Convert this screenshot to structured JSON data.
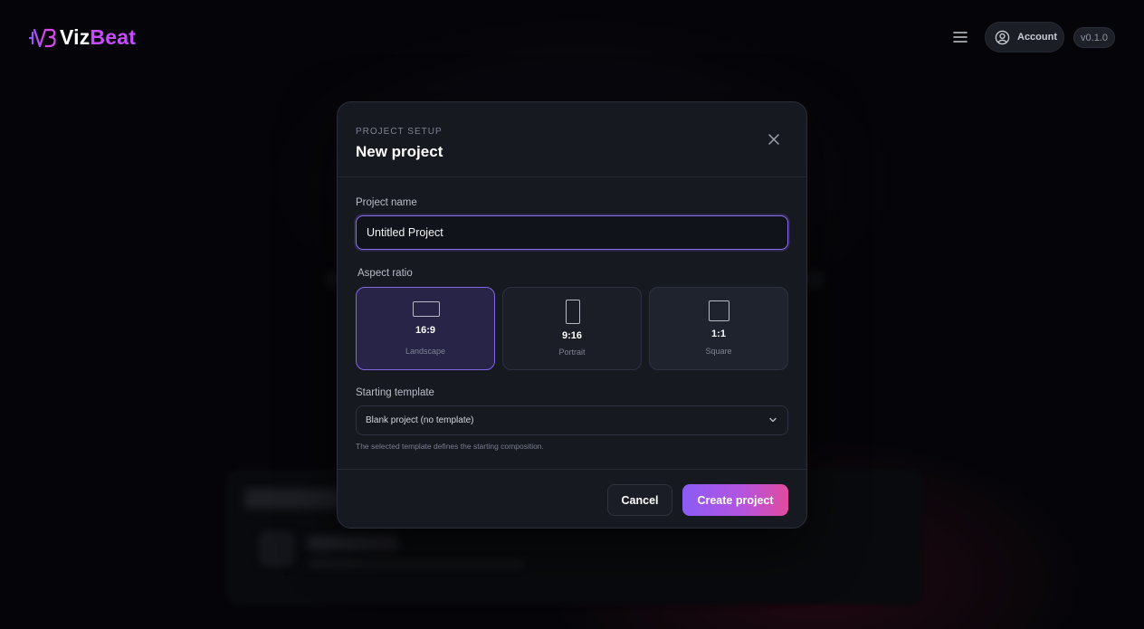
{
  "brand": {
    "prefix": "Viz",
    "suffix": "Beat",
    "accent": "#c84bff"
  },
  "header": {
    "account_label": "Account",
    "version": "v0.1.0",
    "menu_icon": "hamburger-icon",
    "account_icon": "user-circle-icon"
  },
  "modal": {
    "eyebrow": "PROJECT SETUP",
    "title": "New project",
    "close_icon": "close-icon",
    "name_label": "Project name",
    "name_value": "Untitled Project",
    "aspect_label": "Aspect ratio",
    "aspect_ratios": [
      {
        "value": "16:9",
        "name": "Landscape",
        "selected": true
      },
      {
        "value": "9:16",
        "name": "Portrait",
        "selected": false
      },
      {
        "value": "1:1",
        "name": "Square",
        "selected": false
      }
    ],
    "template_label": "Starting template",
    "template_value": "Blank project (no template)",
    "template_helper": "The selected template defines the starting composition.",
    "cancel_label": "Cancel",
    "create_label": "Create project"
  },
  "colors": {
    "accent": "#8b5cf6",
    "gradient_end": "#e14b9f",
    "selected_border": "#7f67e6"
  }
}
